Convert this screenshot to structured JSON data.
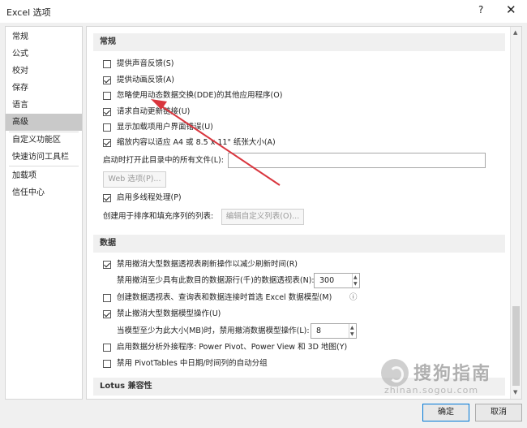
{
  "window": {
    "title": "Excel 选项",
    "help_glyph": "?",
    "close_glyph": "✕"
  },
  "sidebar": {
    "items": [
      {
        "label": "常规"
      },
      {
        "label": "公式"
      },
      {
        "label": "校对"
      },
      {
        "label": "保存"
      },
      {
        "label": "语言"
      },
      {
        "label": "高级",
        "active": true
      },
      {
        "label": "自定义功能区"
      },
      {
        "label": "快速访问工具栏"
      },
      {
        "label": "加载项"
      },
      {
        "label": "信任中心"
      }
    ]
  },
  "general": {
    "header": "常规",
    "opt_sound": {
      "label": "提供声音反馈(S)",
      "checked": false
    },
    "opt_animation": {
      "label": "提供动画反馈(A)",
      "checked": true
    },
    "opt_ignore_dde": {
      "label": "忽略使用动态数据交换(DDE)的其他应用程序(O)",
      "checked": false
    },
    "opt_update_links": {
      "label": "请求自动更新链接(U)",
      "checked": true
    },
    "opt_addin_errors": {
      "label": "显示加载项用户界面错误(U)",
      "checked": false
    },
    "opt_scale_a4": {
      "label": "缩放内容以适应 A4 或 8.5 x 11\" 纸张大小(A)",
      "checked": true
    },
    "startup_label": "启动时打开此目录中的所有文件(L):",
    "startup_value": "",
    "web_options_button": "Web 选项(P)...",
    "opt_multithread": {
      "label": "启用多线程处理(P)",
      "checked": true
    },
    "sort_lists_label": "创建用于排序和填充序列的列表:",
    "edit_lists_button": "编辑自定义列表(O)..."
  },
  "data": {
    "header": "数据",
    "opt_disable_undo_pivot": {
      "label": "禁用撤消大型数据透视表刷新操作以减少刷新时间(R)",
      "checked": true
    },
    "pivot_rows_label": "禁用撤消至少具有此数目的数据源行(千)的数据透视表(N):",
    "pivot_rows_value": "300",
    "opt_prefer_model": {
      "label": "创建数据透视表、查询表和数据连接时首选 Excel 数据模型(M)",
      "checked": false,
      "info_glyph": "ⓘ"
    },
    "opt_disable_undo_model": {
      "label": "禁止撤消大型数据模型操作(U)",
      "checked": true
    },
    "model_size_label": "当模型至少为此大小(MB)时，禁用撤消数据模型操作(L):",
    "model_size_value": "8",
    "opt_addins": {
      "label": "启用数据分析外接程序: Power Pivot、Power View 和 3D 地图(Y)",
      "checked": false
    },
    "opt_pivot_date_group": {
      "label": "禁用 PivotTables 中日期/时间列的自动分组",
      "checked": false
    }
  },
  "lotus": {
    "header": "Lotus 兼容性"
  },
  "footer": {
    "ok": "确定",
    "cancel": "取消"
  },
  "watermark": {
    "cn": "搜狗指南",
    "en": "zhinan.sogou.com"
  },
  "colors": {
    "annotation_arrow": "#d9363e",
    "active_item": "#c9c9c9",
    "section_bg": "#f0f0f0",
    "ok_border": "#0078d7"
  }
}
